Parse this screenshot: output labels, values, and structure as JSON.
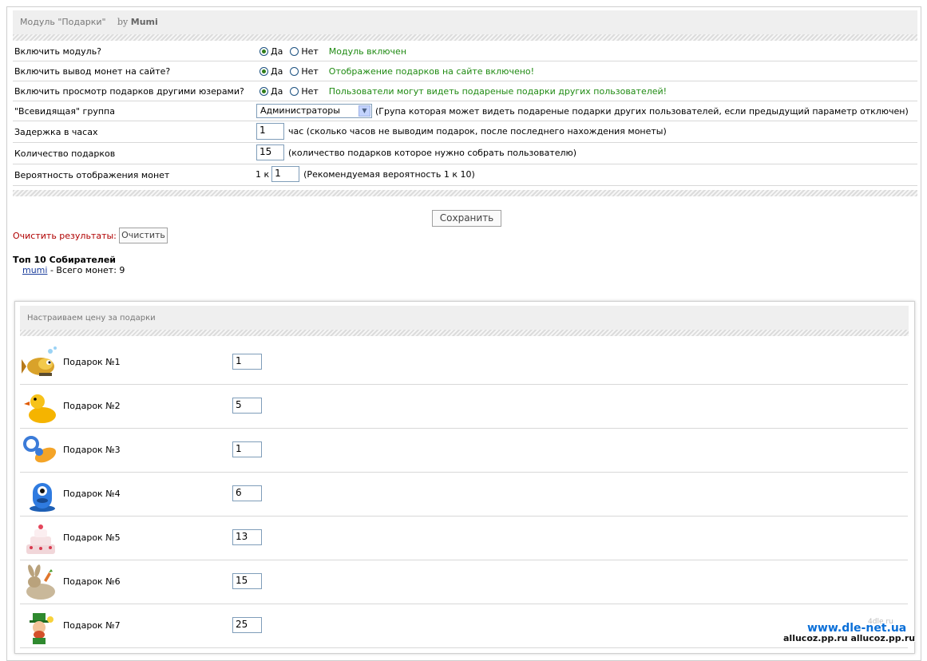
{
  "header": {
    "title": "Модуль \"Подарки\"",
    "by": "by",
    "author": "Mumi"
  },
  "settings": [
    {
      "label": "Включить модуль?",
      "yes": "Да",
      "no": "Нет",
      "status": "Модуль включен"
    },
    {
      "label": "Включить вывод монет на сайте?",
      "yes": "Да",
      "no": "Нет",
      "status": "Отображение подарков на сайте включено!"
    },
    {
      "label": "Включить просмотр подарков другими юзерами?",
      "yes": "Да",
      "no": "Нет",
      "status": "Пользователи могут видеть подареные подарки других пользователей!"
    },
    {
      "label": "\"Всевидящая\" группа",
      "select_value": "Администраторы",
      "hint": "(Група которая может видеть подареные подарки других пользователей, если предыдущий параметр отключен)"
    },
    {
      "label": "Задержка в часах",
      "value": "1",
      "hint": "час (сколько часов не выводим подарок, после последнего нахождения монеты)"
    },
    {
      "label": "Количество подарков",
      "value": "15",
      "hint": "(количество подарков которое нужно собрать пользователю)"
    },
    {
      "label": "Вероятность отображения монет",
      "prefix": "1 к",
      "value": "1",
      "hint": "(Рекомендуемая вероятность 1 к 10)"
    }
  ],
  "save_label": "Сохранить",
  "clear": {
    "label": "Очистить результаты:",
    "button": "Очистить"
  },
  "top": {
    "title": "Топ 10 Собирателей",
    "user": "mumi",
    "text": "- Всего монет: 9"
  },
  "prices": {
    "title": "Настраиваем цену за подарки",
    "gifts": [
      {
        "name": "Подарок №1",
        "value": "1",
        "icon": "fish-icon"
      },
      {
        "name": "Подарок №2",
        "value": "5",
        "icon": "duck-icon"
      },
      {
        "name": "Подарок №3",
        "value": "1",
        "icon": "pacifier-icon"
      },
      {
        "name": "Подарок №4",
        "value": "6",
        "icon": "blue-monster-icon"
      },
      {
        "name": "Подарок №5",
        "value": "13",
        "icon": "cake-icon"
      },
      {
        "name": "Подарок №6",
        "value": "15",
        "icon": "rabbit-icon"
      },
      {
        "name": "Подарок №7",
        "value": "25",
        "icon": "leprechaun-icon"
      }
    ]
  },
  "watermarks": {
    "site": "www.dle-net.ua",
    "mirrors": "allucoz.pp.ru allucoz.pp.ru",
    "faint": "4dle.ru"
  }
}
